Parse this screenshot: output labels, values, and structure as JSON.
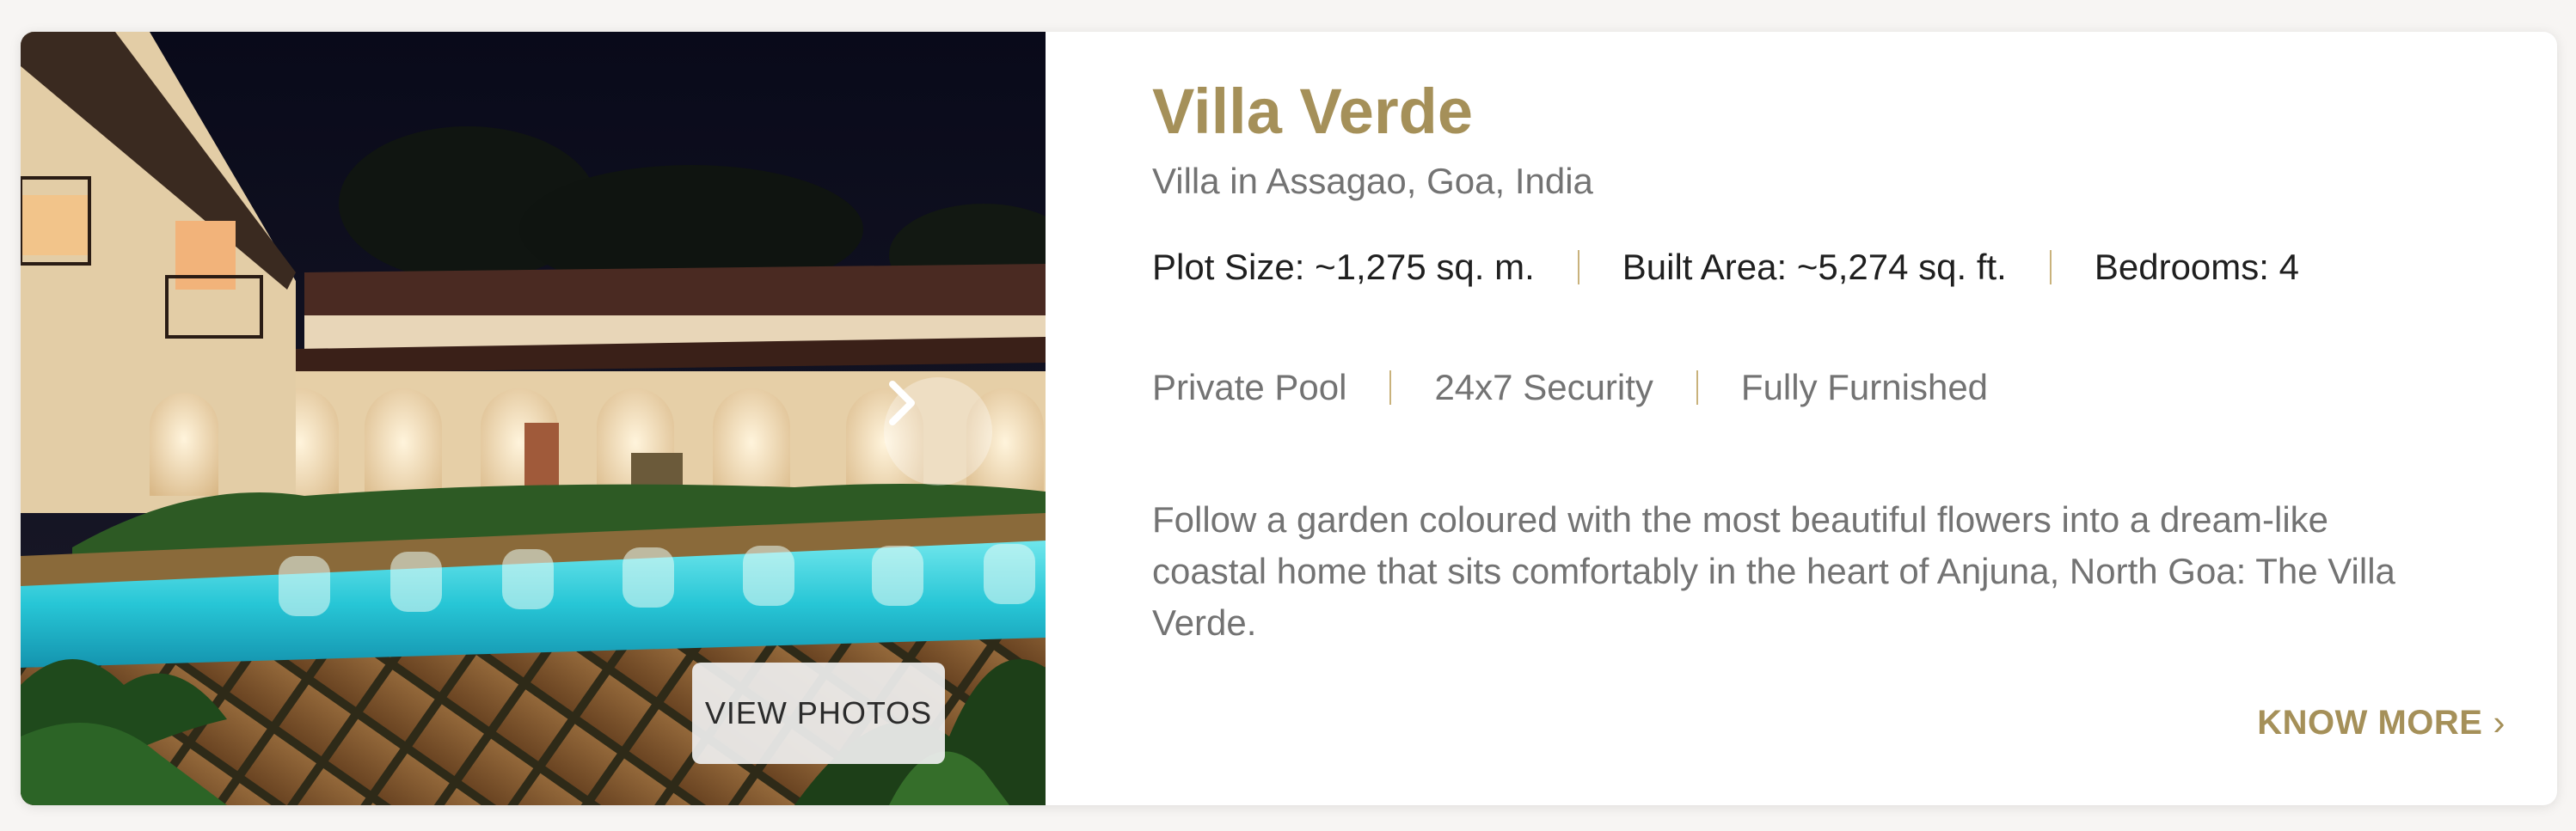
{
  "property": {
    "title": "Villa Verde",
    "subtitle": "Villa in Assagao, Goa, India",
    "specs": [
      "Plot Size: ~1,275 sq. m.",
      "Built Area: ~5,274 sq. ft.",
      "Bedrooms: 4"
    ],
    "features": [
      "Private Pool",
      "24x7 Security",
      "Fully Furnished"
    ],
    "description": "Follow a garden coloured with the most beautiful flowers into a dream-like coastal home that sits comfortably in the heart of Anjuna, North Goa: The Villa Verde.",
    "know_more_label": "KNOW MORE",
    "know_more_icon": "chevron-right-icon"
  },
  "gallery": {
    "view_photos_label": "VIEW PHOTOS",
    "next_icon": "chevron-right-icon"
  },
  "colors": {
    "accent": "#a59059",
    "separator": "#c9b27c",
    "muted_text": "#737373",
    "body_text": "#1f1f1f",
    "background": "#f7f5f3",
    "card": "#ffffff"
  }
}
